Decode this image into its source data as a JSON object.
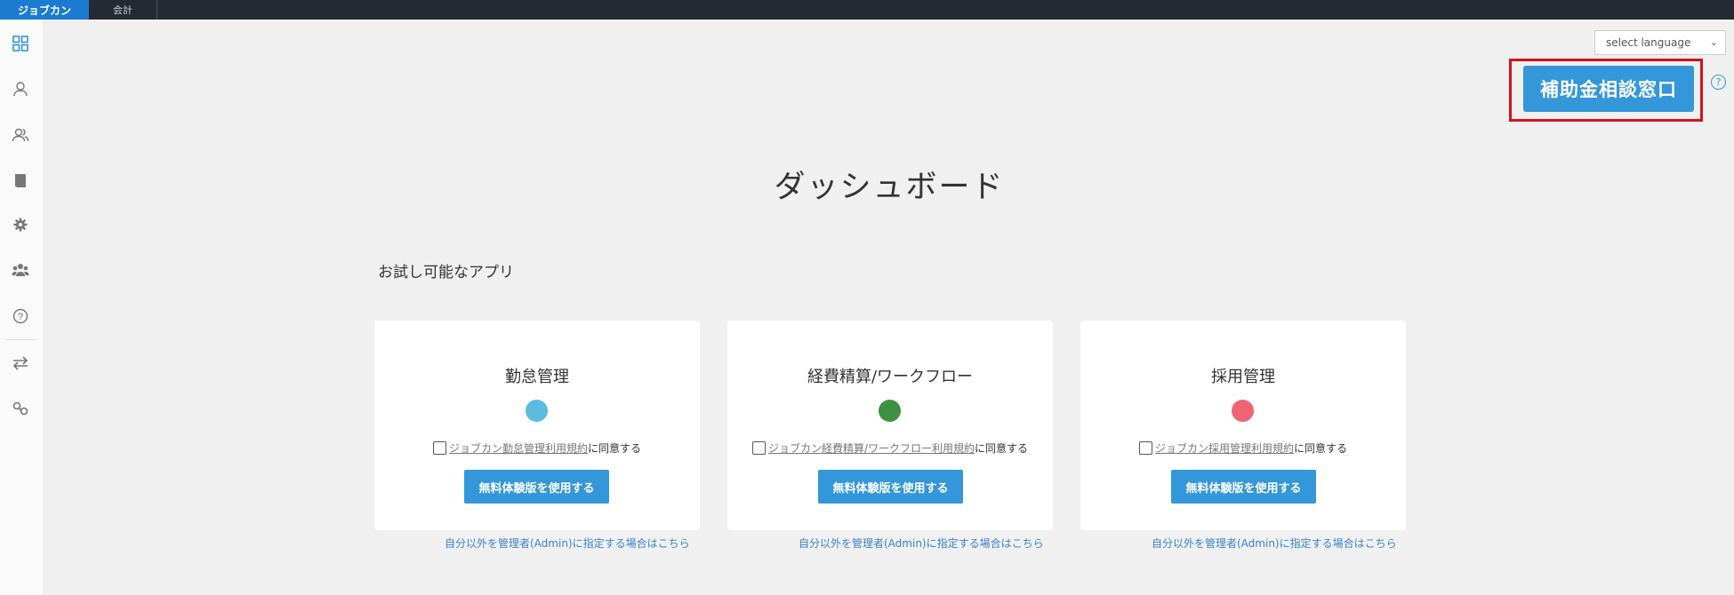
{
  "topbar": {
    "tabs": [
      {
        "label": "ジョブカン"
      },
      {
        "label": "会計"
      }
    ]
  },
  "sidebar": {
    "icons": [
      "dashboard-icon",
      "user-icon",
      "users-icon",
      "book-icon",
      "gear-icon",
      "group-icon",
      "help-icon",
      "switch-icon",
      "link-icon"
    ]
  },
  "language": {
    "value": "select language"
  },
  "subsidy": {
    "label": "補助金相談窓口",
    "help": "?"
  },
  "page": {
    "title": "ダッシュボード",
    "section": "お試し可能なアプリ"
  },
  "colors": {
    "accent": "#3497d9",
    "highlight": "#d9101c"
  },
  "cards": [
    {
      "name": "勤怠管理",
      "color": "#5bbcdf",
      "terms_link": "ジョブカン勤怠管理利用規約",
      "terms_suffix": "に同意する",
      "button": "無料体験版を使用する",
      "admin_link": "自分以外を管理者(Admin)に指定する場合はこちら"
    },
    {
      "name": "経費精算/ワークフロー",
      "color": "#3d9140",
      "terms_link": "ジョブカン経費精算/ワークフロー利用規約",
      "terms_suffix": "に同意する",
      "button": "無料体験版を使用する",
      "admin_link": "自分以外を管理者(Admin)に指定する場合はこちら"
    },
    {
      "name": "採用管理",
      "color": "#ef6473",
      "terms_link": "ジョブカン採用管理利用規約",
      "terms_suffix": "に同意する",
      "button": "無料体験版を使用する",
      "admin_link": "自分以外を管理者(Admin)に指定する場合はこちら"
    }
  ]
}
